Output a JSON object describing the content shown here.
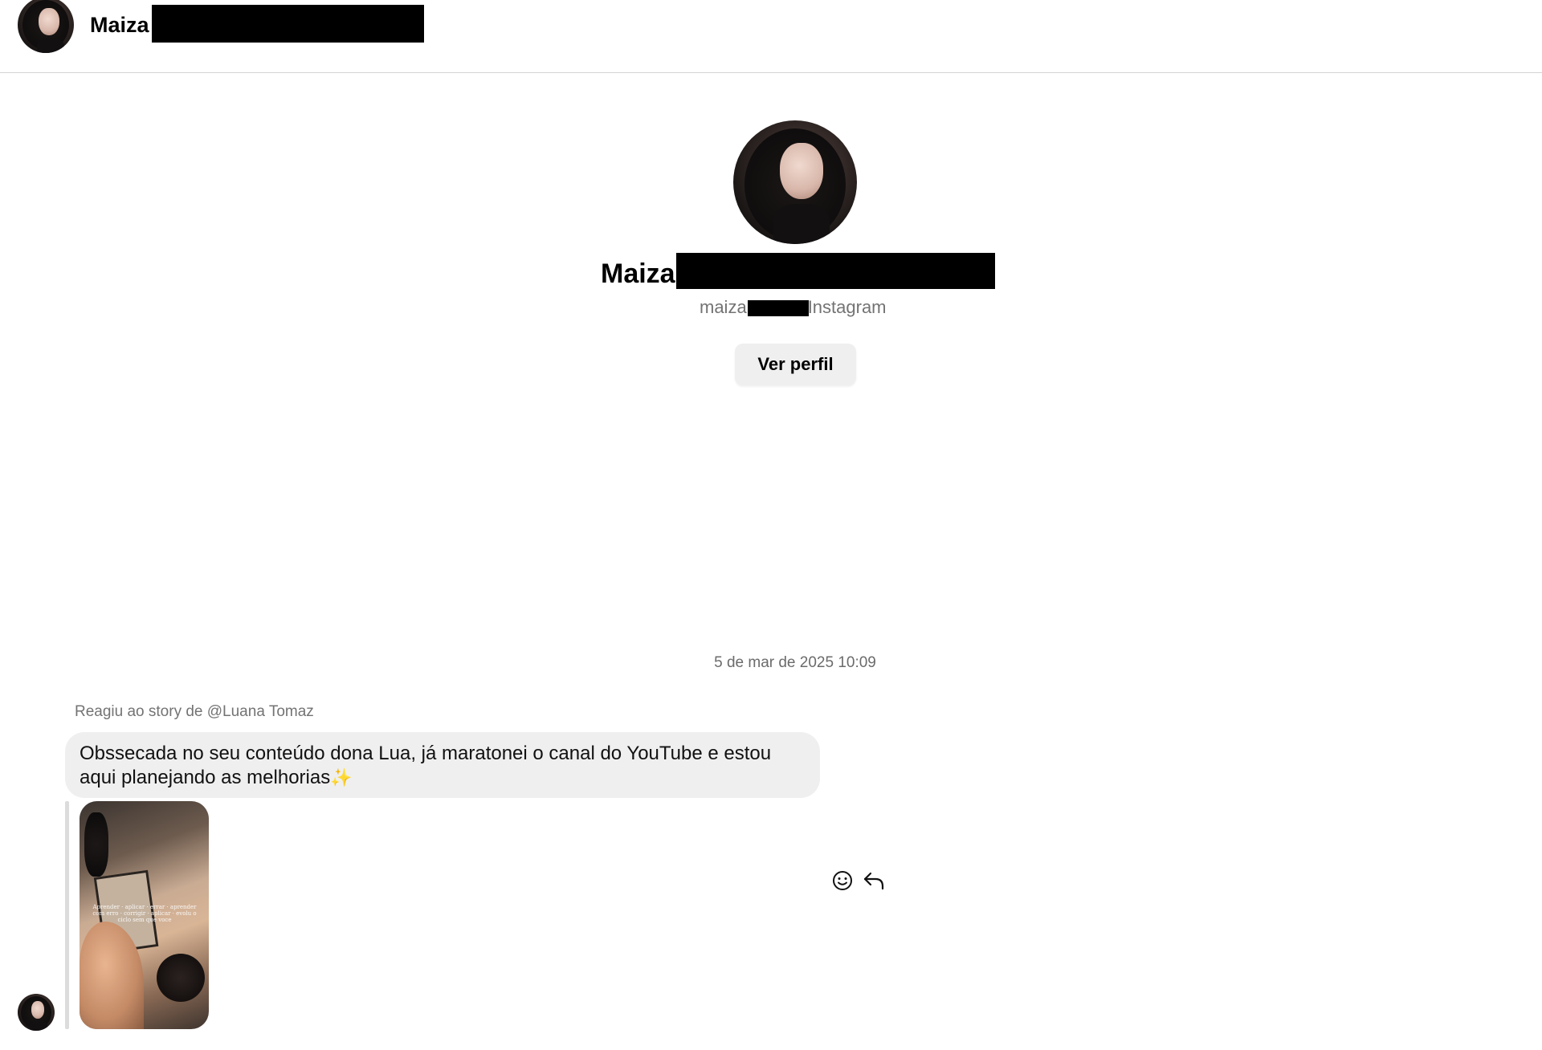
{
  "header": {
    "name": "Maiza"
  },
  "profile": {
    "name": "Maiza",
    "handle_prefix": "maiza",
    "handle_suffix": "Instagram",
    "view_profile_label": "Ver perfil"
  },
  "conversation": {
    "timestamp": "5 de mar de 2025 10:09",
    "reaction_label": "Reagiu ao story de @Luana Tomaz",
    "message_text": "Obssecada no seu conteúdo dona Lua, já maratonei o canal do YouTube e estou aqui planejando as melhorias",
    "sparkle": "✨",
    "story_overlay_text": "Aprender · aplicar · errar · aprender com erro · corrigir · aplicar · evolu o ciclo sem que voce"
  },
  "icons": {
    "emoji": "smiley-icon",
    "reply": "reply-arrow-icon"
  },
  "colors": {
    "bubble": "#efefef",
    "button": "#efefef",
    "secondary_text": "#737373",
    "divider": "#d4d4d4"
  }
}
